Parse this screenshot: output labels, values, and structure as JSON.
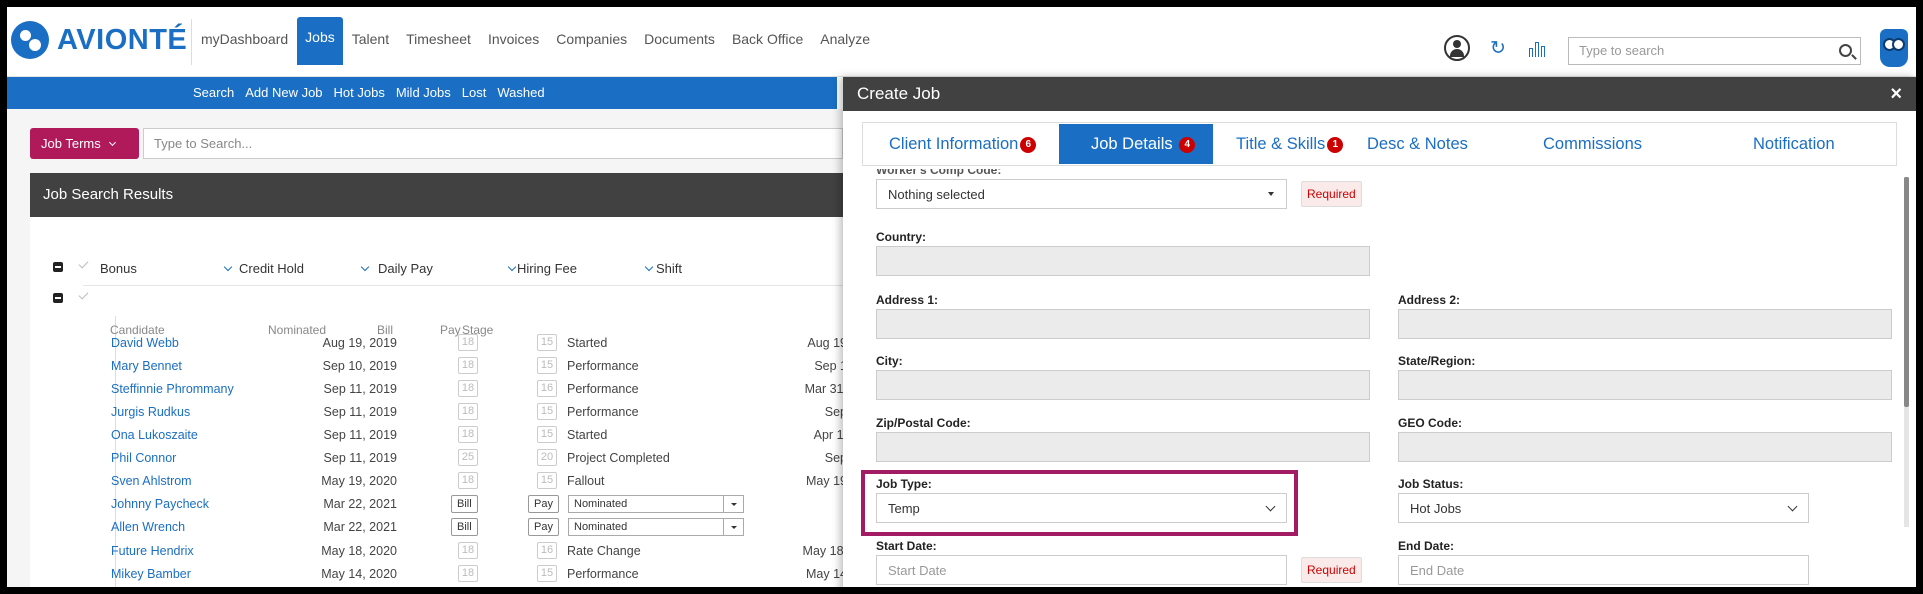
{
  "brand": {
    "name": "AVIONTÉ"
  },
  "topnav": {
    "items": [
      "myDashboard",
      "Jobs",
      "Talent",
      "Timesheet",
      "Invoices",
      "Companies",
      "Documents",
      "Back Office",
      "Analyze"
    ],
    "search_placeholder": "Type to search"
  },
  "subnav": {
    "items": [
      "Search",
      "Add New Job",
      "Hot Jobs",
      "Mild Jobs",
      "Lost",
      "Washed"
    ]
  },
  "left": {
    "job_terms_label": "Job Terms",
    "search_placeholder": "Type to Search...",
    "results_title": "Job Search Results",
    "columns": [
      "Bonus",
      "Credit Hold",
      "Daily Pay",
      "Hiring Fee",
      "Shift"
    ],
    "sub_headers": {
      "candidate": "Candidate",
      "nominated": "Nominated",
      "bill": "Bill",
      "pay": "Pay",
      "stage": "Stage"
    },
    "rows": [
      {
        "name": "David Webb",
        "nominated": "Aug 19, 2019",
        "bill": "18",
        "pay": "15",
        "stage": "Started",
        "date2": "Aug 19"
      },
      {
        "name": "Mary Bennet",
        "nominated": "Sep 10, 2019",
        "bill": "18",
        "pay": "15",
        "stage": "Performance",
        "date2": "Sep 1"
      },
      {
        "name": "Steffinnie Phrommany",
        "nominated": "Sep 11, 2019",
        "bill": "18",
        "pay": "16",
        "stage": "Performance",
        "date2": "Mar 31,"
      },
      {
        "name": "Jurgis Rudkus",
        "nominated": "Sep 11, 2019",
        "bill": "18",
        "pay": "15",
        "stage": "Performance",
        "date2": "Sep"
      },
      {
        "name": "Ona Lukoszaite",
        "nominated": "Sep 11, 2019",
        "bill": "18",
        "pay": "15",
        "stage": "Started",
        "date2": "Apr 1,"
      },
      {
        "name": "Phil Connor",
        "nominated": "Sep 11, 2019",
        "bill": "25",
        "pay": "20",
        "stage": "Project Completed",
        "date2": "Sep"
      },
      {
        "name": "Sven Ahlstrom",
        "nominated": "May 19, 2020",
        "bill": "18",
        "pay": "15",
        "stage": "Fallout",
        "date2": "May 19"
      },
      {
        "name": "Johnny Paycheck",
        "nominated": "Mar 22, 2021",
        "bill": "Bill",
        "pay": "Pay",
        "stage": "Nominated",
        "date2": ""
      },
      {
        "name": "Allen Wrench",
        "nominated": "Mar 22, 2021",
        "bill": "Bill",
        "pay": "Pay",
        "stage": "Nominated",
        "date2": ""
      },
      {
        "name": "Future Hendrix",
        "nominated": "May 18, 2020",
        "bill": "18",
        "pay": "16",
        "stage": "Rate Change",
        "date2": "May 18,"
      },
      {
        "name": "Mikey Bamber",
        "nominated": "May 14, 2020",
        "bill": "18",
        "pay": "15",
        "stage": "Performance",
        "date2": "May 14"
      }
    ]
  },
  "modal": {
    "title": "Create Job",
    "close": "×",
    "tabs": [
      {
        "label": "Client Information",
        "badge": "6"
      },
      {
        "label": "Job Details",
        "badge": "4"
      },
      {
        "label": "Title & Skills",
        "badge": "1"
      },
      {
        "label": "Desc & Notes",
        "badge": ""
      },
      {
        "label": "Commissions",
        "badge": ""
      },
      {
        "label": "Notification",
        "badge": ""
      }
    ],
    "form": {
      "workers_comp_label": "Worker's Comp Code:",
      "workers_comp_value": "Nothing selected",
      "required": "Required",
      "country": "Country:",
      "address1": "Address 1:",
      "address2": "Address 2:",
      "city": "City:",
      "state": "State/Region:",
      "zip": "Zip/Postal Code:",
      "geo": "GEO Code:",
      "job_type_label": "Job Type:",
      "job_type_value": "Temp",
      "job_status_label": "Job Status:",
      "job_status_value": "Hot Jobs",
      "start_date_label": "Start Date:",
      "start_date_placeholder": "Start Date",
      "end_date_label": "End Date:",
      "end_date_placeholder": "End Date"
    }
  }
}
